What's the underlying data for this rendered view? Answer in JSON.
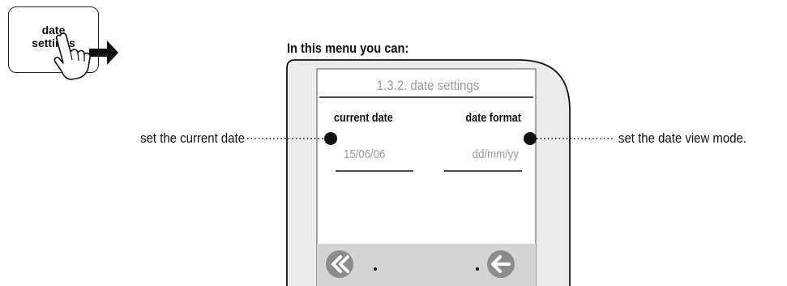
{
  "button": {
    "label_line1": "date",
    "label_line2": "settings"
  },
  "heading": "In this menu you can:",
  "screen": {
    "title": "1.3.2. date settings",
    "fields": [
      {
        "label": "current date",
        "value": "15/06/06"
      },
      {
        "label": "date format",
        "value": "dd/mm/yy"
      }
    ]
  },
  "callouts": {
    "left": "set the current date",
    "right": "set the date view mode."
  },
  "icons": {
    "back": "double-chevron-left-icon",
    "return": "arrow-left-icon",
    "hand": "pointing-hand-icon",
    "arrow": "arrow-right-icon"
  },
  "colors": {
    "frame": "#ebebeb",
    "nav_bar": "#d4d4d4",
    "nav_button": "#8c8c8c",
    "muted_text": "#9a9a9a"
  }
}
